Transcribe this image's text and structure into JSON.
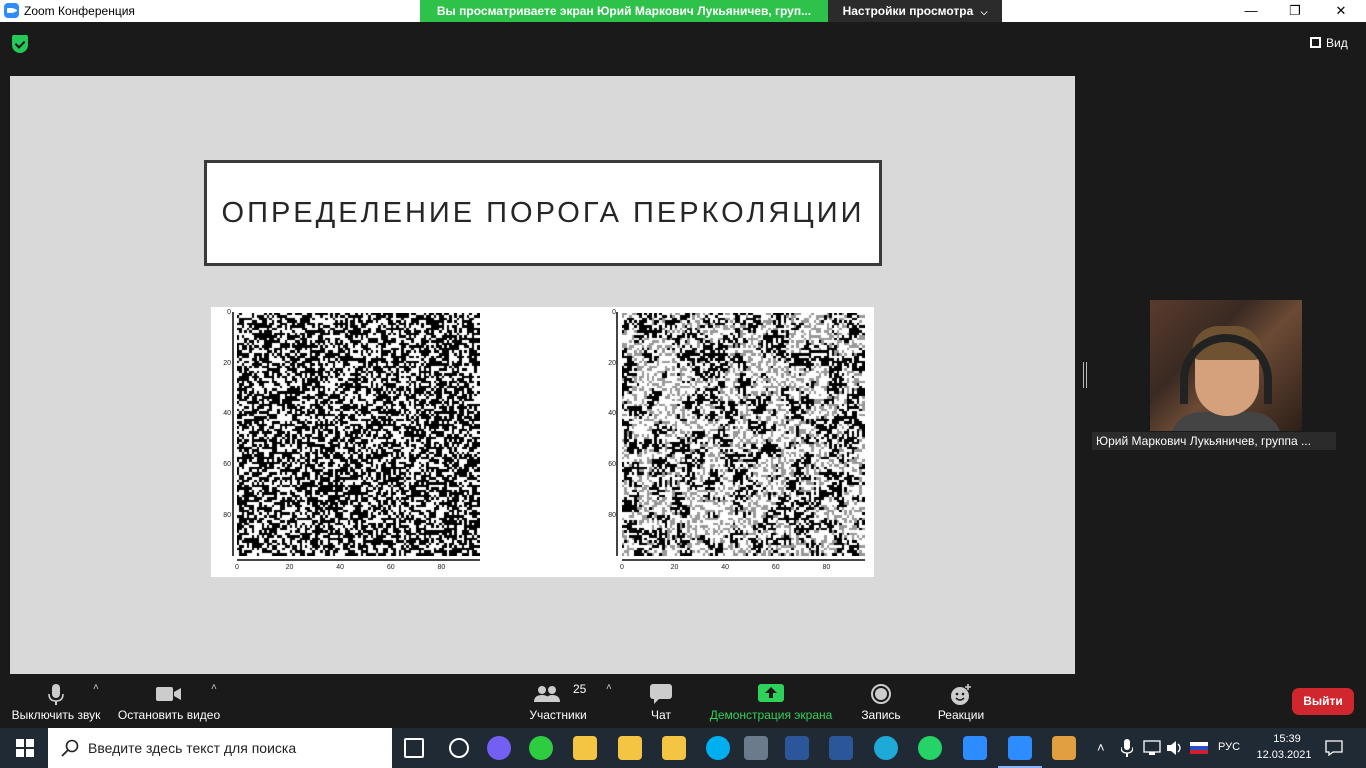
{
  "window": {
    "title": "Zoom Конференция",
    "share_banner": "Вы просматриваете экран Юрий Маркович Лукьяничев, груп...",
    "view_settings": "Настройки просмотра",
    "controls": {
      "minimize": "—",
      "maximize": "❐",
      "close": "✕"
    }
  },
  "meeting": {
    "view_button": "Вид",
    "slide": {
      "title": "ОПРЕДЕЛЕНИЕ ПОРОГА ПЕРКОЛЯЦИИ",
      "plots": [
        {
          "name": "binary",
          "colors": [
            "#000000",
            "#ffffff"
          ],
          "y_ticks": [
            "0",
            "20",
            "40",
            "60",
            "80"
          ],
          "x_ticks": [
            "0",
            "20",
            "40",
            "60",
            "80"
          ]
        },
        {
          "name": "clusters",
          "colors": [
            "#000000",
            "#ffffff",
            "#999999"
          ],
          "y_ticks": [
            "0",
            "20",
            "40",
            "60",
            "80"
          ],
          "x_ticks": [
            "0",
            "20",
            "40",
            "60",
            "80"
          ]
        }
      ]
    },
    "participant": {
      "name": "Юрий Маркович Лукьяничев, группа ..."
    }
  },
  "toolbar": {
    "mute": "Выключить звук",
    "stop_video": "Остановить видео",
    "participants": "Участники",
    "participants_count": "25",
    "chat": "Чат",
    "share_screen": "Демонстрация экрана",
    "record": "Запись",
    "reactions": "Реакции",
    "leave": "Выйти"
  },
  "taskbar": {
    "search_placeholder": "Введите здесь текст для поиска",
    "language": "РУС",
    "time": "15:39",
    "date": "12.03.2021",
    "apps": [
      {
        "name": "task-view-icon",
        "color": "#ffffff"
      },
      {
        "name": "settings-gear-icon",
        "color": "#ffffff"
      },
      {
        "name": "viber-icon",
        "color": "#7360f2"
      },
      {
        "name": "icq-icon",
        "color": "#2ecc40"
      },
      {
        "name": "folder-icon",
        "color": "#f4c542"
      },
      {
        "name": "folder-icon-2",
        "color": "#f4c542"
      },
      {
        "name": "folder-icon-3",
        "color": "#f4c542"
      },
      {
        "name": "skype-icon",
        "color": "#00aff0"
      },
      {
        "name": "calculator-icon",
        "color": "#6b7b8c"
      },
      {
        "name": "word-icon",
        "color": "#2b579a"
      },
      {
        "name": "word-icon-2",
        "color": "#2b579a"
      },
      {
        "name": "edge-icon",
        "color": "#1fa9d6"
      },
      {
        "name": "whatsapp-icon",
        "color": "#25d366"
      },
      {
        "name": "zoom-icon",
        "color": "#2d8cff"
      },
      {
        "name": "zoom-meeting-icon",
        "color": "#2d8cff"
      },
      {
        "name": "paint-icon",
        "color": "#e0a040"
      }
    ]
  }
}
